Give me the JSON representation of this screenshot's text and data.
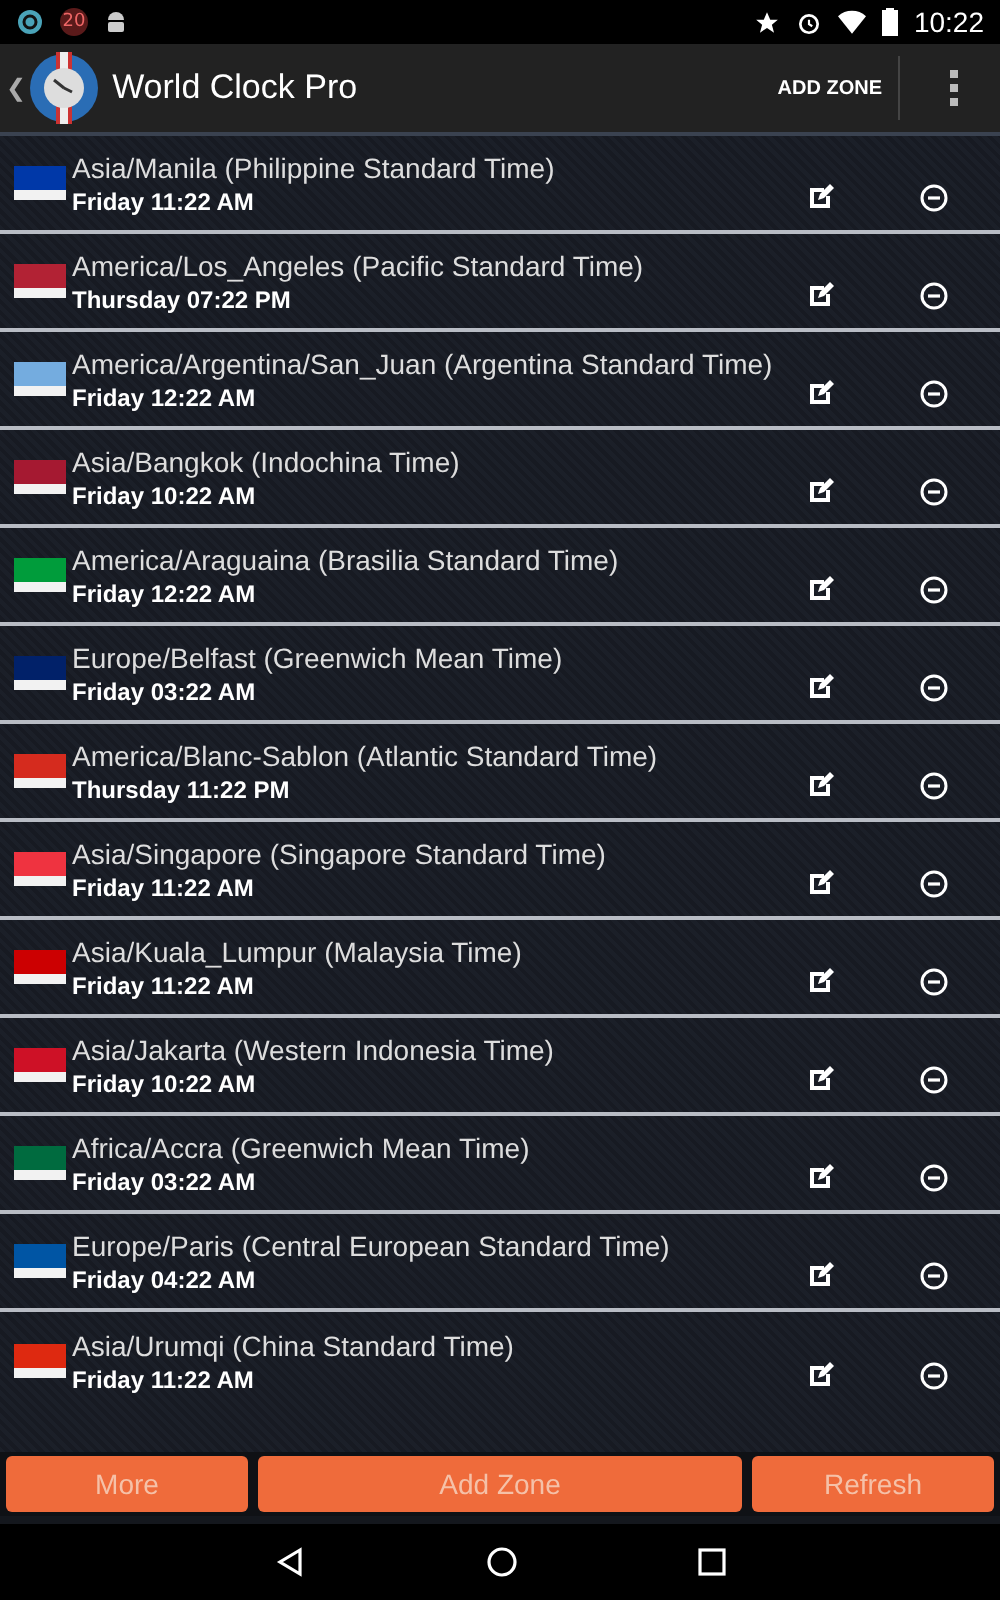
{
  "status_bar": {
    "time": "10:22",
    "notification_badge": "20"
  },
  "app_bar": {
    "back": "❮",
    "title": "World Clock Pro",
    "action": "ADD ZONE"
  },
  "zones": [
    {
      "name": "Asia/Manila (Philippine Standard Time)",
      "day": "Friday",
      "time": "11:22 AM",
      "color": "#0038a8"
    },
    {
      "name": "America/Los_Angeles (Pacific Standard Time)",
      "day": "Thursday",
      "time": "07:22 PM",
      "color": "#b22234"
    },
    {
      "name": "America/Argentina/San_Juan (Argentina Standard Time)",
      "day": "Friday",
      "time": "12:22 AM",
      "color": "#74acdf"
    },
    {
      "name": "Asia/Bangkok (Indochina Time)",
      "day": "Friday",
      "time": "10:22 AM",
      "color": "#a51931"
    },
    {
      "name": "America/Araguaina (Brasilia Standard Time)",
      "day": "Friday",
      "time": "12:22 AM",
      "color": "#009c3b"
    },
    {
      "name": "Europe/Belfast (Greenwich Mean Time)",
      "day": "Friday",
      "time": "03:22 AM",
      "color": "#012169"
    },
    {
      "name": "America/Blanc-Sablon (Atlantic Standard Time)",
      "day": "Thursday",
      "time": "11:22 PM",
      "color": "#d52b1e"
    },
    {
      "name": "Asia/Singapore (Singapore Standard Time)",
      "day": "Friday",
      "time": "11:22 AM",
      "color": "#ef3340"
    },
    {
      "name": "Asia/Kuala_Lumpur (Malaysia Time)",
      "day": "Friday",
      "time": "11:22 AM",
      "color": "#cc0001"
    },
    {
      "name": "Asia/Jakarta (Western Indonesia Time)",
      "day": "Friday",
      "time": "10:22 AM",
      "color": "#ce1126"
    },
    {
      "name": "Africa/Accra (Greenwich Mean Time)",
      "day": "Friday",
      "time": "03:22 AM",
      "color": "#006b3f"
    },
    {
      "name": "Europe/Paris (Central European Standard Time)",
      "day": "Friday",
      "time": "04:22 AM",
      "color": "#0055a4"
    },
    {
      "name": "Asia/Urumqi (China Standard Time)",
      "day": "Friday",
      "time": "11:22 AM",
      "color": "#de2910"
    }
  ],
  "buttons": [
    "More",
    "Add Zone",
    "Refresh"
  ]
}
